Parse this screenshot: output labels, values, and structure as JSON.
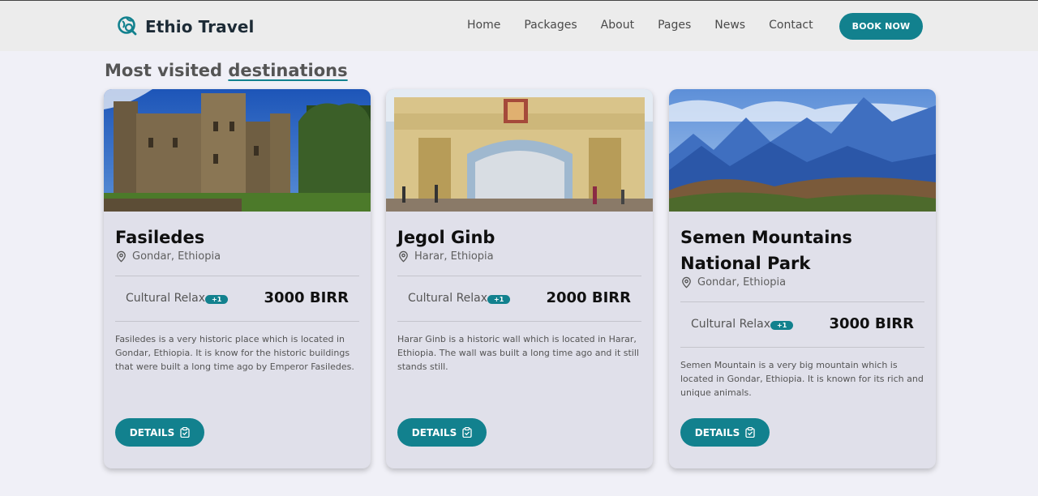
{
  "brand": {
    "name": "Ethio Travel",
    "logo_icon": "globe-search-icon"
  },
  "nav": {
    "links": [
      "Home",
      "Packages",
      "About",
      "Pages",
      "News",
      "Contact"
    ],
    "book_label": "BOOK NOW"
  },
  "section": {
    "title_prefix": "Most visited ",
    "title_highlight": "destinations"
  },
  "cards": [
    {
      "title": "Fasiledes",
      "location": "Gondar, Ethiopia",
      "category": "Cultural Relax",
      "badge": "+1",
      "price": "3000 BIRR",
      "description": "Fasiledes is a very historic place which is located in Gondar, Ethiopia. It is know for the historic buildings that were built a long time ago by Emperor Fasiledes.",
      "button": "DETAILS"
    },
    {
      "title": "Jegol Ginb",
      "location": "Harar, Ethiopia",
      "category": "Cultural Relax",
      "badge": "+1",
      "price": "2000 BIRR",
      "description": "Harar Ginb is a historic wall which is located in Harar, Ethiopia. The wall was built a long time ago and it still stands still.",
      "button": "DETAILS"
    },
    {
      "title": "Semen Mountains National Park",
      "location": "Gondar, Ethiopia",
      "category": "Cultural Relax",
      "badge": "+1",
      "price": "3000 BIRR",
      "description": "Semen Mountain is a very big mountain which is located in Gondar, Ethiopia. It is known for its rich and unique animals.",
      "button": "DETAILS"
    }
  ],
  "colors": {
    "accent": "#12818e",
    "background": "#f0f0f7",
    "card": "#e0e0ea"
  }
}
